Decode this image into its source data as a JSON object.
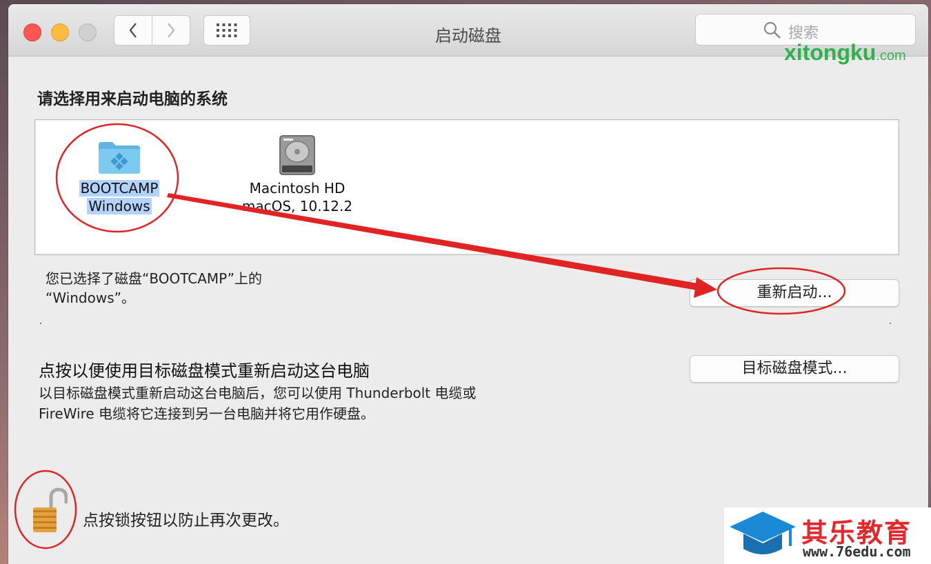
{
  "window": {
    "title": "启动磁盘"
  },
  "toolbar": {
    "search_placeholder": "搜索"
  },
  "watermark_top": {
    "name": "xitongku",
    "tld": ".com"
  },
  "main": {
    "heading": "请选择用来启动电脑的系统",
    "disks": [
      {
        "name": "BOOTCAMP",
        "system": "Windows",
        "icon": "bootcamp-folder-icon",
        "selected": true
      },
      {
        "name": "Macintosh HD",
        "system": "macOS, 10.12.2",
        "icon": "hard-drive-icon",
        "selected": false
      }
    ],
    "selection_line1": "您已选择了磁盘“BOOTCAMP”上的",
    "selection_line2": "“Windows”。",
    "restart_button": "重新启动...",
    "target_mode_title": "点按以便使用目标磁盘模式重新启动这台电脑",
    "target_mode_desc1": "以目标磁盘模式重新启动这台电脑后，您可以使用 Thunderbolt 电缆或",
    "target_mode_desc2": "FireWire 电缆将它连接到另一台电脑并将它用作硬盘。",
    "target_mode_button": "目标磁盘模式...",
    "lock_text": "点按锁按钮以防止再次更改。"
  },
  "watermark_br": {
    "name": "其乐教育",
    "url": "www.76edu.com"
  },
  "colors": {
    "annotation_red": "#e02424",
    "selection_blue": "#b3d3fd",
    "brand_green": "#2fb24c"
  }
}
